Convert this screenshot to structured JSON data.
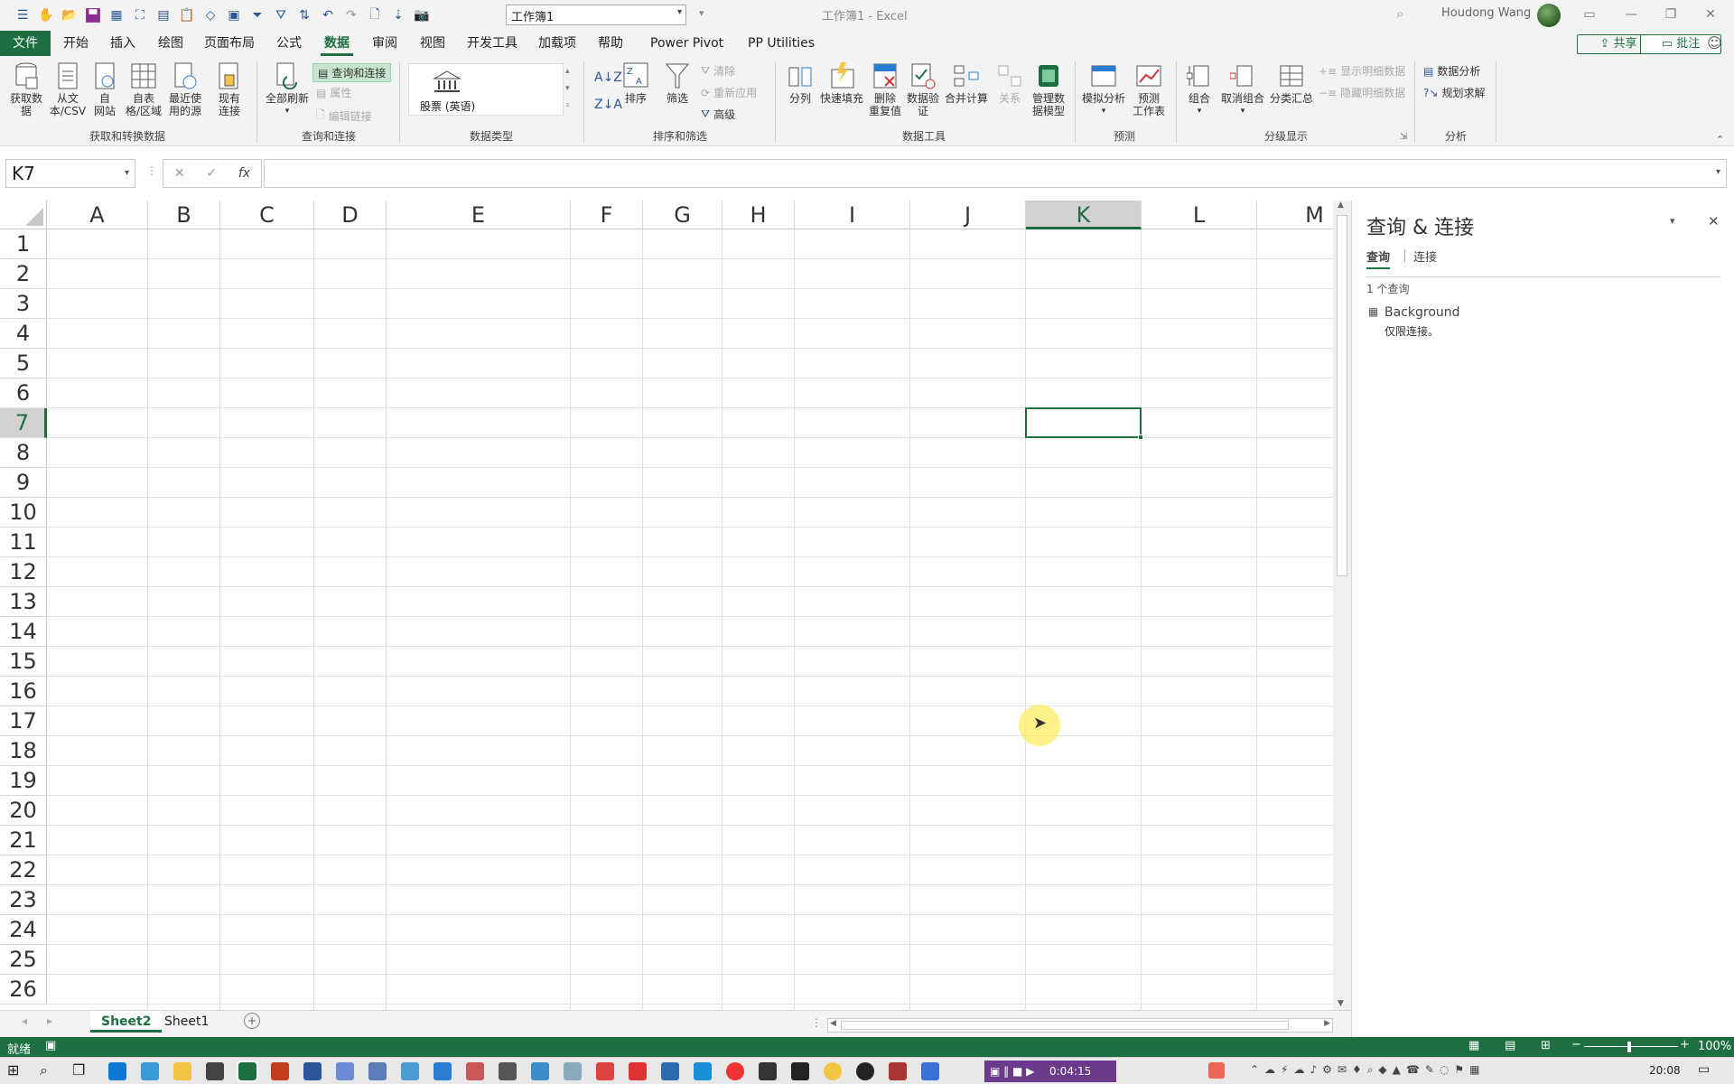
{
  "titlebar": {
    "filename": "工作簿1",
    "window_title": "工作簿1  -  Excel",
    "user": "Houdong Wang"
  },
  "tabs": [
    {
      "label": "文件",
      "active": false
    },
    {
      "label": "开始",
      "active": false
    },
    {
      "label": "插入",
      "active": false
    },
    {
      "label": "绘图",
      "active": false
    },
    {
      "label": "页面布局",
      "active": false
    },
    {
      "label": "公式",
      "active": false
    },
    {
      "label": "数据",
      "active": true
    },
    {
      "label": "审阅",
      "active": false
    },
    {
      "label": "视图",
      "active": false
    },
    {
      "label": "开发工具",
      "active": false
    },
    {
      "label": "加载项",
      "active": false
    },
    {
      "label": "帮助",
      "active": false
    },
    {
      "label": "Power Pivot",
      "active": false
    },
    {
      "label": "PP Utilities",
      "active": false
    }
  ],
  "share_label": "共享",
  "comment_label": "批注",
  "ribbon": {
    "get_data": "获取数\n据",
    "from_csv": "从文\n本/CSV",
    "from_web": "自\n网站",
    "from_table": "自表\n格/区域",
    "recent_sources": "最近使\n用的源",
    "existing_conn": "现有\n连接",
    "group_get": "获取和转换数据",
    "refresh_all": "全部刷新",
    "queries_conn": "查询和连接",
    "properties": "属性",
    "edit_links": "编辑链接",
    "group_queries": "查询和连接",
    "stocks": "股票 (英语)",
    "group_datatype": "数据类型",
    "sort": "排序",
    "filter": "筛选",
    "clear": "清除",
    "reapply": "重新应用",
    "advanced": "高级",
    "group_sort": "排序和筛选",
    "text_to_cols": "分列",
    "flash_fill": "快速填充",
    "remove_dup": "删除\n重复值",
    "validation": "数据验\n证",
    "consolidate": "合并计算",
    "relations": "关系",
    "data_model": "管理数\n据模型",
    "group_tools": "数据工具",
    "what_if": "模拟分析",
    "forecast_sheet": "预测\n工作表",
    "group_forecast": "预测",
    "group_btn": "组合",
    "ungroup": "取消组合",
    "subtotal": "分类汇总",
    "show_detail": "显示明细数据",
    "hide_detail": "隐藏明细数据",
    "group_outline": "分级显示",
    "data_analysis": "数据分析",
    "solver": "规划求解",
    "group_analysis": "分析"
  },
  "formula": {
    "namebox": "K7",
    "fx": "fx"
  },
  "columns": [
    "A",
    "B",
    "C",
    "D",
    "E",
    "F",
    "G",
    "H",
    "I",
    "J",
    "K",
    "L",
    "M"
  ],
  "rows": [
    "1",
    "2",
    "3",
    "4",
    "5",
    "6",
    "7",
    "8",
    "9",
    "10",
    "11",
    "12",
    "13",
    "14",
    "15",
    "16",
    "17",
    "18",
    "19",
    "20",
    "21",
    "22",
    "23",
    "24",
    "25",
    "26"
  ],
  "selected": {
    "col": "K",
    "row": "7"
  },
  "sheets": [
    {
      "label": "Sheet2",
      "active": true
    },
    {
      "label": "Sheet1",
      "active": false
    }
  ],
  "pane": {
    "title": "查询 & 连接",
    "tab_queries": "查询",
    "tab_connections": "连接",
    "count": "1 个查询",
    "query_name": "Background",
    "query_desc": "仅限连接。"
  },
  "status": {
    "ready": "就绪",
    "zoom": "100%"
  },
  "taskbar": {
    "timer": "0:04:15",
    "clock": "20:08"
  },
  "colors": {
    "accent": "#1d6f42"
  }
}
